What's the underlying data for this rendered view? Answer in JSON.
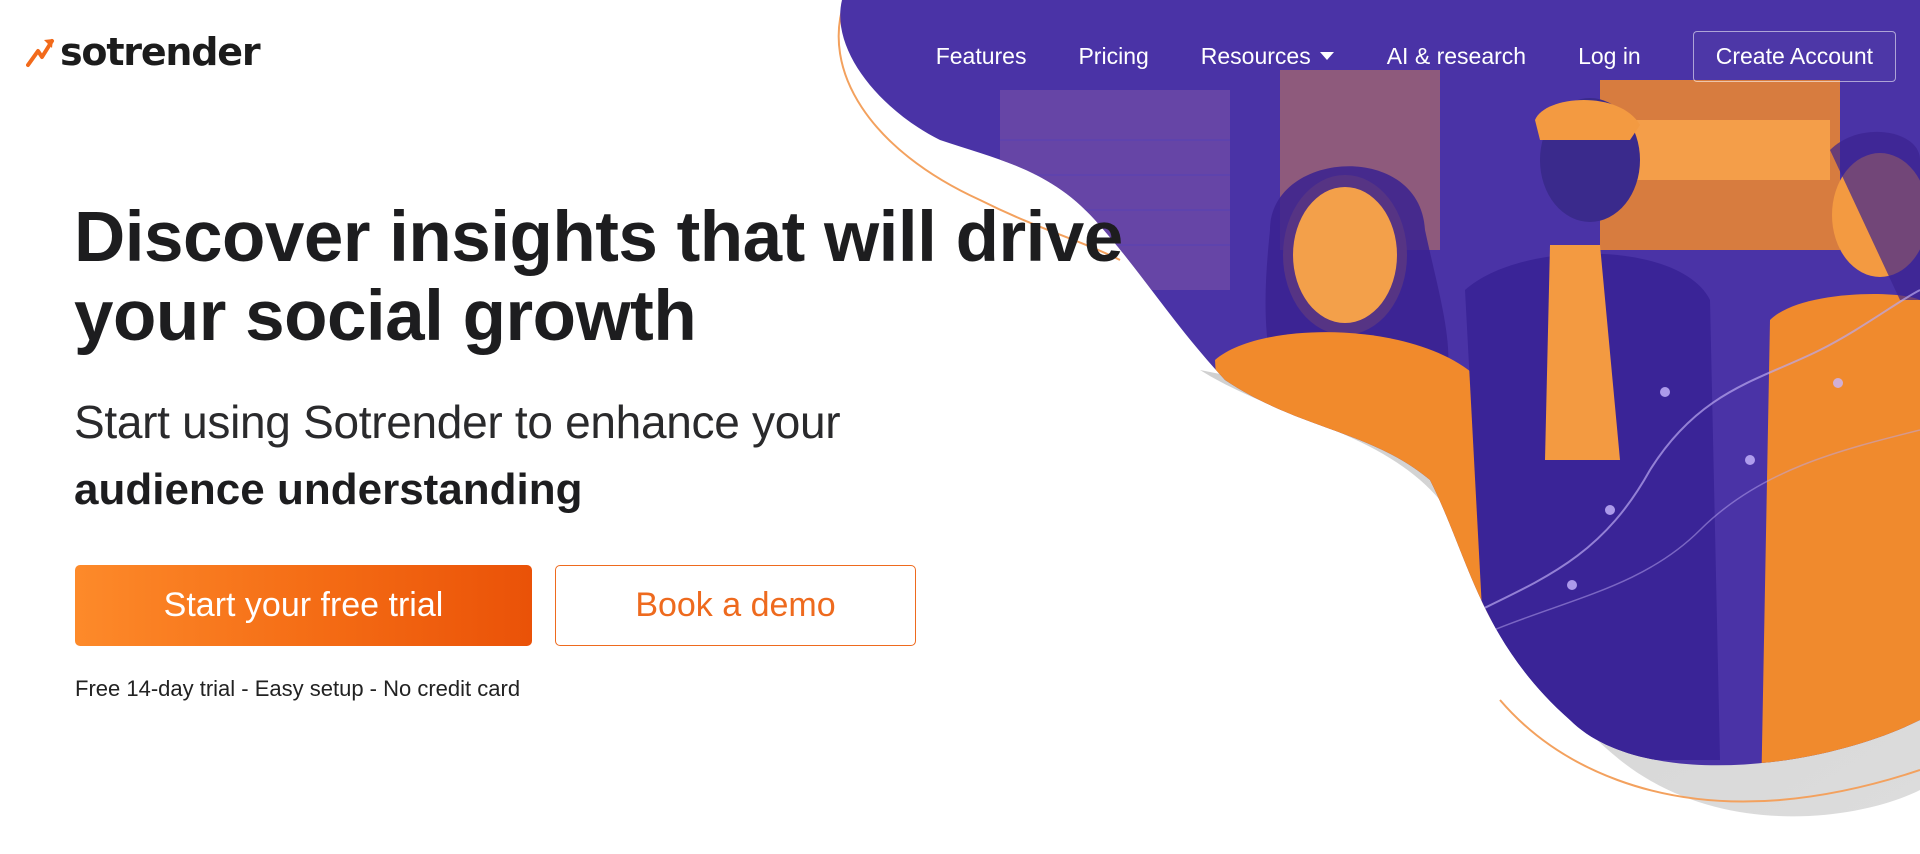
{
  "brand": {
    "name": "sotrender",
    "accent": "#f26a1b",
    "hero_purple": "#4a33a6"
  },
  "nav": {
    "items": [
      {
        "label": "Features"
      },
      {
        "label": "Pricing"
      },
      {
        "label": "Resources",
        "has_dropdown": true
      },
      {
        "label": "AI & research"
      },
      {
        "label": "Log in"
      }
    ],
    "create_account": "Create Account"
  },
  "hero": {
    "title_line1": "Discover insights that will drive",
    "title_line2": "your social growth",
    "subtitle_light": "Start using Sotrender to enhance your",
    "subtitle_bold": "audience understanding",
    "primary_cta": "Start your free trial",
    "secondary_cta": "Book a demo",
    "note": "Free 14-day trial - Easy setup - No credit card",
    "image_subject": "three people walking and smiling, duotone purple and orange"
  },
  "icons": {
    "logo_mark": "logo-arrow-icon",
    "dropdown": "chevron-down-icon"
  }
}
